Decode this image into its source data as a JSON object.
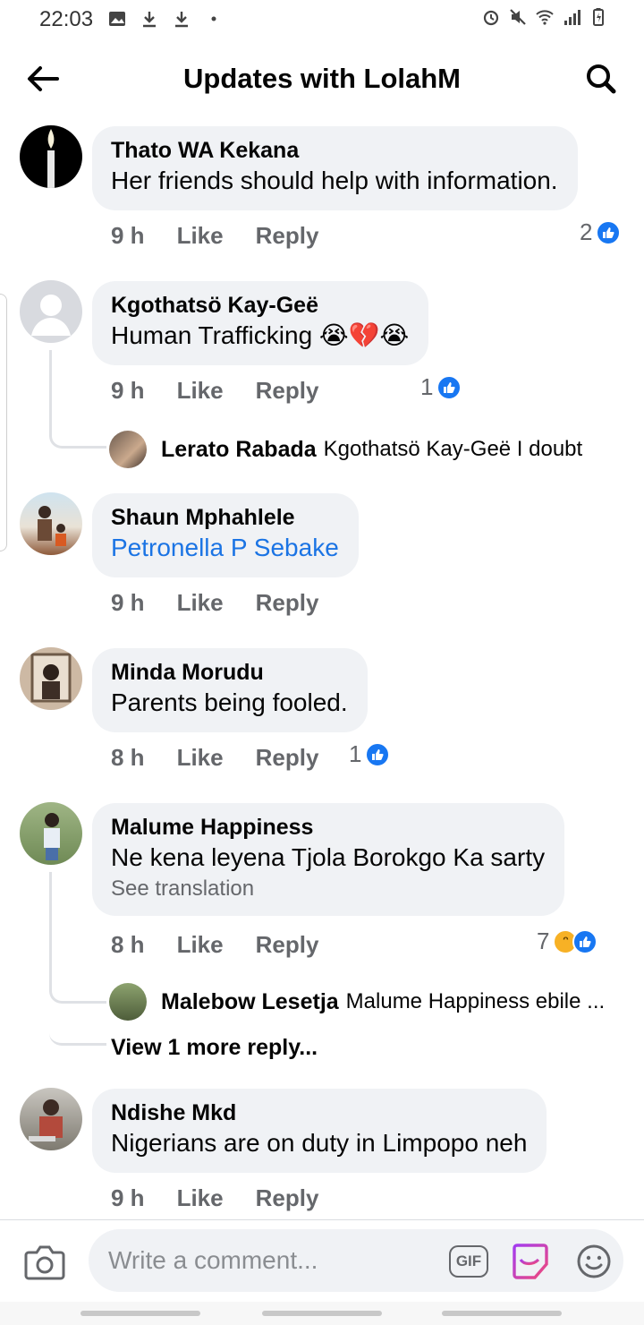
{
  "status_bar": {
    "time": "22:03"
  },
  "header": {
    "title": "Updates with LolahM"
  },
  "comments": [
    {
      "author": "Thato WA Kekana",
      "text": "Her friends should help with information.",
      "time": "9 h",
      "like": "Like",
      "reply": "Reply",
      "reaction_count": "2"
    },
    {
      "author": "Kgothatsö Kay-Geë",
      "text": "Human Trafficking 😭💔😭",
      "time": "9 h",
      "like": "Like",
      "reply": "Reply",
      "reaction_count": "1",
      "replies": [
        {
          "author": "Lerato Rabada",
          "text": "Kgothatsö Kay-Geë I doubt"
        }
      ]
    },
    {
      "author": "Shaun Mphahlele",
      "text": "Petronella P Sebake",
      "time": "9 h",
      "like": "Like",
      "reply": "Reply"
    },
    {
      "author": "Minda Morudu",
      "text": "Parents being fooled.",
      "time": "8 h",
      "like": "Like",
      "reply": "Reply",
      "reaction_count": "1"
    },
    {
      "author": "Malume Happiness",
      "text": "Ne kena leyena Tjola Borokgo Ka sarty",
      "see_translation": "See translation",
      "time": "8 h",
      "like": "Like",
      "reply": "Reply",
      "reaction_count": "7",
      "replies": [
        {
          "author": "Malebow Lesetja",
          "text": "Malume Happiness ebile ..."
        }
      ],
      "more_replies": "View 1 more reply..."
    },
    {
      "author": "Ndishe Mkd",
      "text": "Nigerians are on duty in Limpopo neh",
      "time": "9 h",
      "like": "Like",
      "reply": "Reply"
    }
  ],
  "composer": {
    "placeholder": "Write a comment...",
    "gif_label": "GIF"
  },
  "colors": {
    "link": "#1b74e4",
    "like_blue": "#1877f2",
    "bubble": "#f0f2f5",
    "meta_gray": "#65676b"
  },
  "icons": [
    "back-arrow-icon",
    "search-icon",
    "like-icon",
    "haha-icon",
    "camera-icon",
    "gif-icon",
    "sticker-icon",
    "emoji-icon"
  ]
}
